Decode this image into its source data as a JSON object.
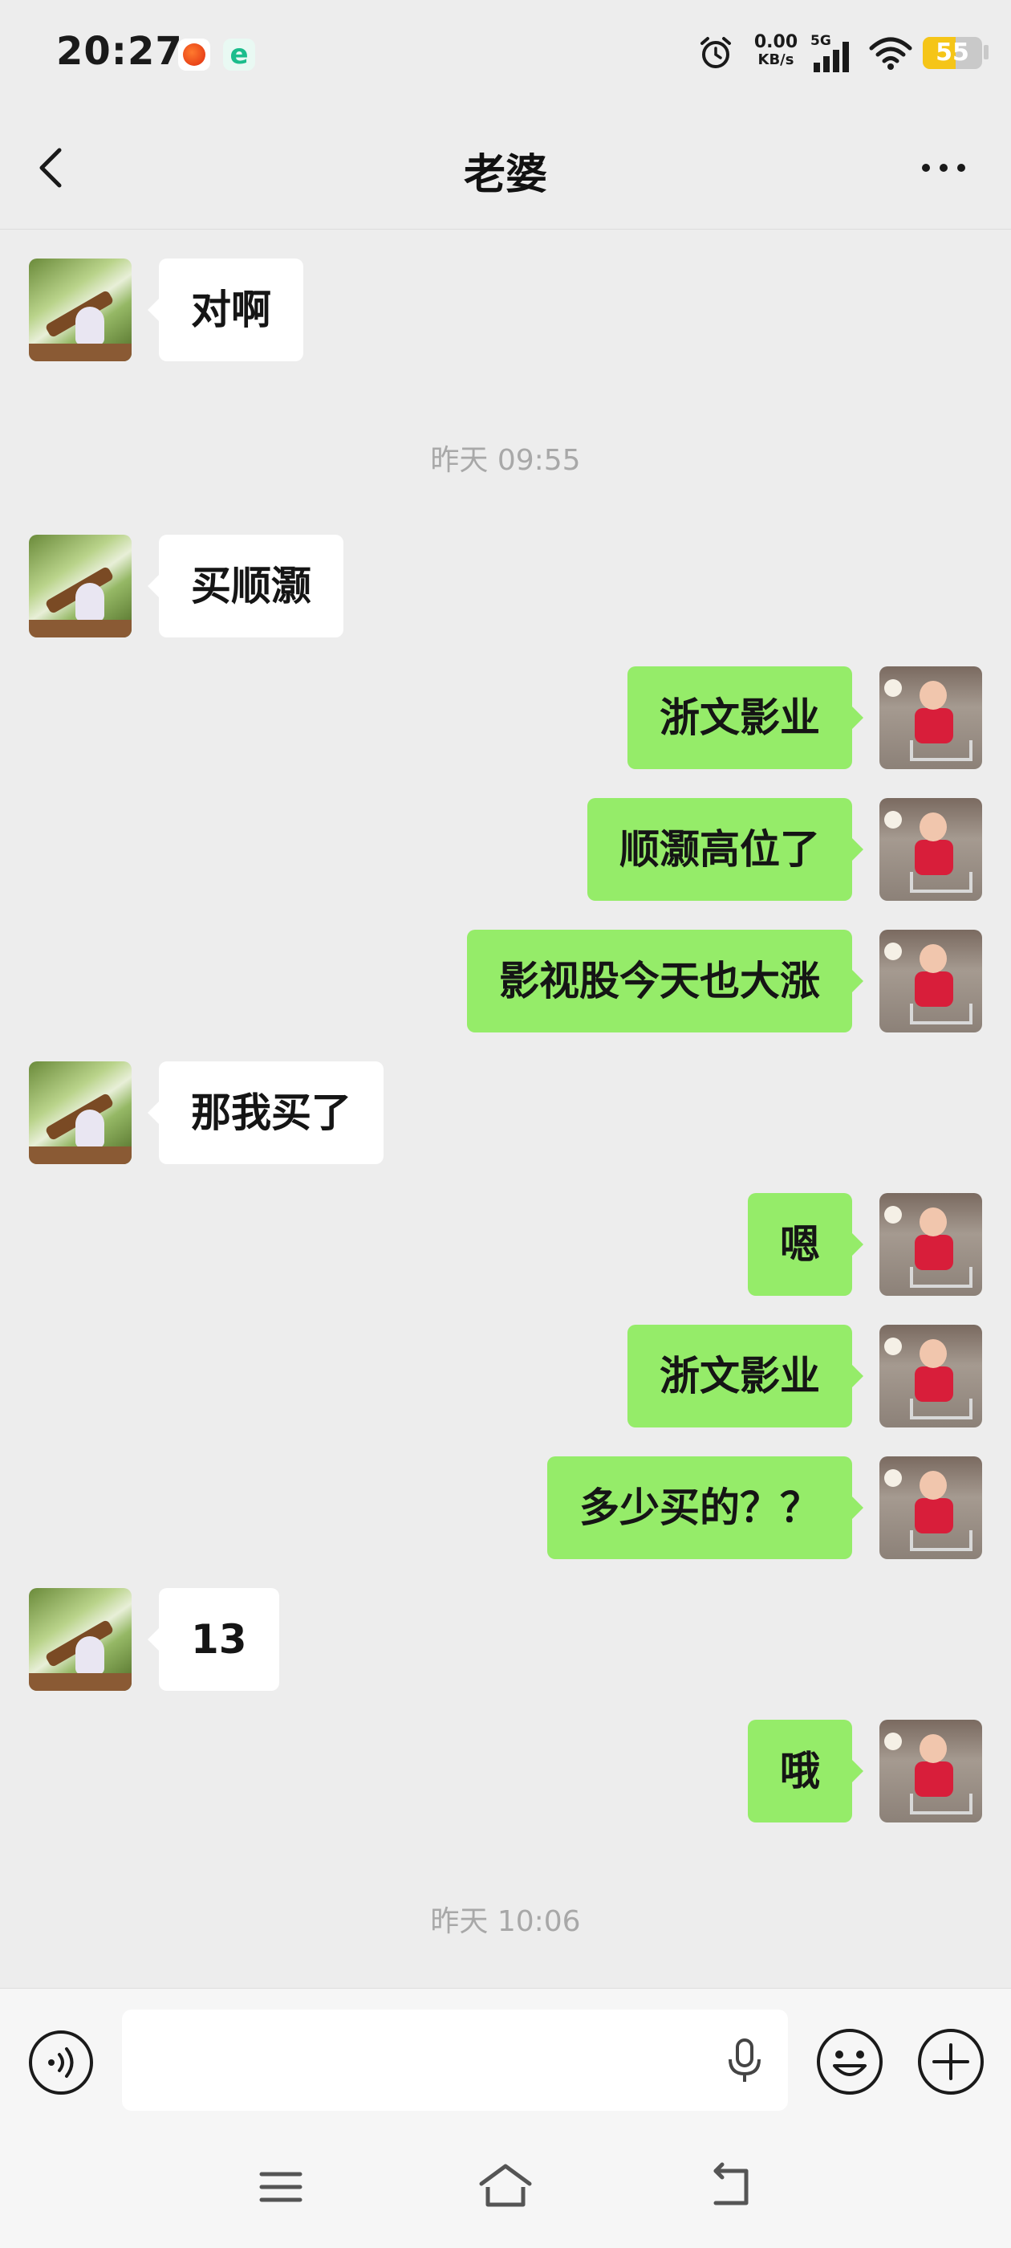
{
  "status_bar": {
    "time": "20:27",
    "net_speed_value": "0.00",
    "net_speed_unit": "KB/s",
    "network_type": "5G",
    "battery_level": "55",
    "battery_fraction": 0.55,
    "icons": [
      "notification-app-icon",
      "browser-app-icon",
      "alarm-icon",
      "cellular-signal-icon",
      "wifi-icon",
      "battery-icon"
    ]
  },
  "header": {
    "title": "老婆",
    "back_icon": "chevron-left-icon",
    "more_icon": "more-dots-icon"
  },
  "chat": {
    "timestamps": [
      "昨天 09:55",
      "昨天 10:06"
    ],
    "messages": [
      {
        "side": "left",
        "text": "对啊"
      },
      {
        "side": "left",
        "text": "买顺灏"
      },
      {
        "side": "right",
        "text": "浙文影业"
      },
      {
        "side": "right",
        "text": "顺灏高位了"
      },
      {
        "side": "right",
        "text": "影视股今天也大涨"
      },
      {
        "side": "left",
        "text": "那我买了"
      },
      {
        "side": "right",
        "text": "嗯"
      },
      {
        "side": "right",
        "text": "浙文影业"
      },
      {
        "side": "right",
        "text": "多少买的？？"
      },
      {
        "side": "left",
        "text": "13"
      },
      {
        "side": "right",
        "text": "哦"
      }
    ]
  },
  "input_bar": {
    "value": "",
    "icons": [
      "voice-mode-icon",
      "microphone-icon",
      "emoji-icon",
      "plus-icon"
    ]
  },
  "system_nav": {
    "icons": [
      "menu-icon",
      "home-icon",
      "back-icon"
    ]
  },
  "colors": {
    "background": "#ededed",
    "bubble_self": "#95ec69",
    "bubble_other": "#ffffff",
    "timestamp_text": "#a8a8a8",
    "battery_fill": "#f5c518"
  }
}
